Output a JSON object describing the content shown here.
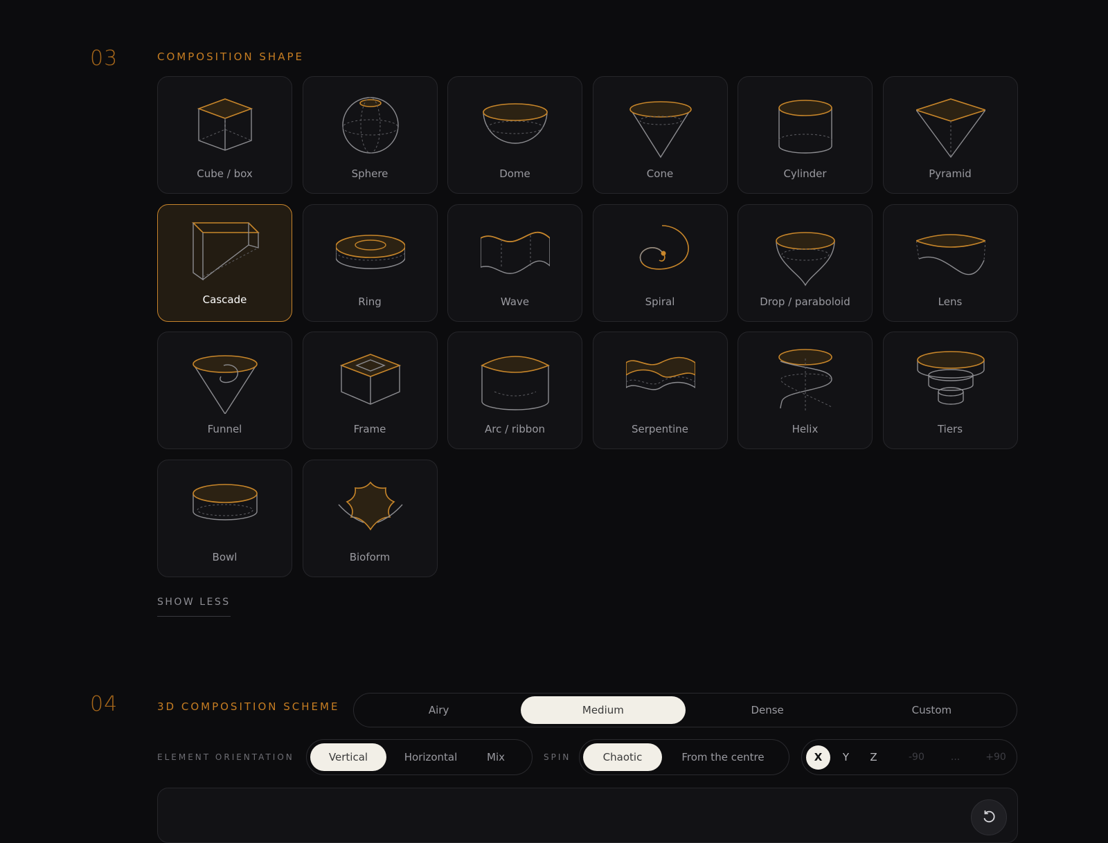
{
  "section3": {
    "number": "03",
    "title": "COMPOSITION SHAPE",
    "shapes": [
      {
        "label": "Cube / box",
        "icon": "cube-icon"
      },
      {
        "label": "Sphere",
        "icon": "sphere-icon"
      },
      {
        "label": "Dome",
        "icon": "dome-icon"
      },
      {
        "label": "Cone",
        "icon": "cone-icon"
      },
      {
        "label": "Cylinder",
        "icon": "cylinder-icon"
      },
      {
        "label": "Pyramid",
        "icon": "pyramid-icon"
      },
      {
        "label": "Cascade",
        "icon": "cascade-icon",
        "selected": true
      },
      {
        "label": "Ring",
        "icon": "ring-icon"
      },
      {
        "label": "Wave",
        "icon": "wave-icon"
      },
      {
        "label": "Spiral",
        "icon": "spiral-icon"
      },
      {
        "label": "Drop / paraboloid",
        "icon": "drop-icon"
      },
      {
        "label": "Lens",
        "icon": "lens-icon"
      },
      {
        "label": "Funnel",
        "icon": "funnel-icon"
      },
      {
        "label": "Frame",
        "icon": "frame-icon"
      },
      {
        "label": "Arc / ribbon",
        "icon": "arc-icon"
      },
      {
        "label": "Serpentine",
        "icon": "serpentine-icon"
      },
      {
        "label": "Helix",
        "icon": "helix-icon"
      },
      {
        "label": "Tiers",
        "icon": "tiers-icon"
      },
      {
        "label": "Bowl",
        "icon": "bowl-icon"
      },
      {
        "label": "Bioform",
        "icon": "bioform-icon"
      }
    ],
    "show_less": "SHOW LESS"
  },
  "section4": {
    "number": "04",
    "title": "3D COMPOSITION SCHEME",
    "density_options": [
      "Airy",
      "Medium",
      "Dense",
      "Custom"
    ],
    "density_selected": "Medium",
    "orientation_label": "ELEMENT ORIENTATION",
    "orientation_options": [
      "Vertical",
      "Horizontal",
      "Mix"
    ],
    "orientation_selected": "Vertical",
    "spin_label": "SPIN",
    "spin_options": [
      "Chaotic",
      "From the centre"
    ],
    "spin_selected": "Chaotic",
    "axes": [
      "X",
      "Y",
      "Z"
    ],
    "axis_selected": "X",
    "range_min": "-90",
    "range_sep": "...",
    "range_max": "+90",
    "reset_icon": "reset-icon"
  },
  "colors": {
    "accent": "#c67d22",
    "background": "#0c0c0e",
    "card": "#121215",
    "selected_fill": "#231c12",
    "pill_active": "#f2efe7"
  }
}
